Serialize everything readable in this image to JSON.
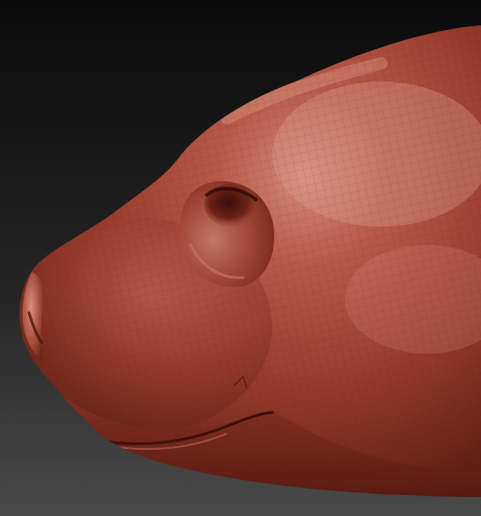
{
  "scene": {
    "subject": "sculpted-head-profile",
    "colors": {
      "background_top": "#0b0b0b",
      "background_bottom": "#4a4a4a",
      "clay_base": "#9a3b2c",
      "clay_light": "#d07a6a",
      "clay_shadow": "#4e1710",
      "wire": "#5a1a12"
    }
  }
}
